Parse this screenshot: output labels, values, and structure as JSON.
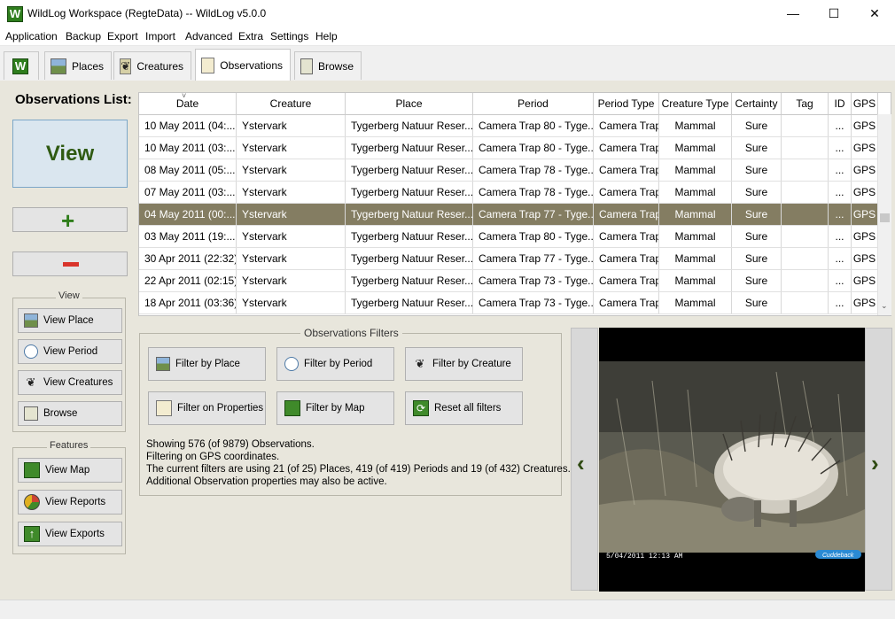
{
  "window": {
    "title": "WildLog Workspace (RegteData) -- WildLog v5.0.0",
    "logo_letter": "W",
    "controls": {
      "minimize": "—",
      "maximize": "☐",
      "close": "✕"
    }
  },
  "menu": [
    "Application",
    "Backup",
    "Export",
    "Import",
    "Advanced",
    "Extra",
    "Settings",
    "Help"
  ],
  "tabs": {
    "home_letter": "W",
    "places": "Places",
    "creatures": "Creatures",
    "observations": "Observations",
    "browse": "Browse"
  },
  "left": {
    "title": "Observations List:",
    "view_button": "View",
    "add_symbol": "+",
    "remove_symbol": "−",
    "view_group": {
      "title": "View",
      "view_place": "View  Place",
      "view_period": "View Period",
      "view_creatures": "View Creatures",
      "browse": "Browse"
    },
    "features_group": {
      "title": "Features",
      "view_map": "View Map",
      "view_reports": "View Reports",
      "view_exports": "View Exports"
    }
  },
  "table": {
    "sort_indicator": "˅",
    "columns": [
      "Date",
      "Creature",
      "Place",
      "Period",
      "Period Type",
      "Creature Type",
      "Certainty",
      "Tag",
      "ID",
      "GPS"
    ],
    "rows": [
      [
        "10 May 2011 (04:...",
        "Ystervark",
        "Tygerberg Natuur Reser...",
        "Camera Trap 80 - Tyge...",
        "Camera Trap",
        "Mammal",
        "Sure",
        "",
        "...",
        "GPS"
      ],
      [
        "10 May 2011 (03:...",
        "Ystervark",
        "Tygerberg Natuur Reser...",
        "Camera Trap 80 - Tyge...",
        "Camera Trap",
        "Mammal",
        "Sure",
        "",
        "...",
        "GPS"
      ],
      [
        "08 May 2011 (05:...",
        "Ystervark",
        "Tygerberg Natuur Reser...",
        "Camera Trap 78 - Tyge...",
        "Camera Trap",
        "Mammal",
        "Sure",
        "",
        "...",
        "GPS"
      ],
      [
        "07 May 2011 (03:...",
        "Ystervark",
        "Tygerberg Natuur Reser...",
        "Camera Trap 78 - Tyge...",
        "Camera Trap",
        "Mammal",
        "Sure",
        "",
        "...",
        "GPS"
      ],
      [
        "04 May 2011 (00:...",
        "Ystervark",
        "Tygerberg Natuur Reser...",
        "Camera Trap 77 - Tyge...",
        "Camera Trap",
        "Mammal",
        "Sure",
        "",
        "...",
        "GPS"
      ],
      [
        "03 May 2011 (19:...",
        "Ystervark",
        "Tygerberg Natuur Reser...",
        "Camera Trap 80 - Tyge...",
        "Camera Trap",
        "Mammal",
        "Sure",
        "",
        "...",
        "GPS"
      ],
      [
        "30 Apr 2011 (22:32)",
        "Ystervark",
        "Tygerberg Natuur Reser...",
        "Camera Trap 77 - Tyge...",
        "Camera Trap",
        "Mammal",
        "Sure",
        "",
        "...",
        "GPS"
      ],
      [
        "22 Apr 2011 (02:15)",
        "Ystervark",
        "Tygerberg Natuur Reser...",
        "Camera Trap 73 - Tyge...",
        "Camera Trap",
        "Mammal",
        "Sure",
        "",
        "...",
        "GPS"
      ],
      [
        "18 Apr 2011 (03:36)",
        "Ystervark",
        "Tygerberg Natuur Reser...",
        "Camera Trap 73 - Tyge...",
        "Camera Trap",
        "Mammal",
        "Sure",
        "",
        "...",
        "GPS"
      ]
    ],
    "selected_row": 4
  },
  "filters": {
    "title": "Observations Filters",
    "by_place": "Filter by Place",
    "by_period": "Filter by Period",
    "by_creature": "Filter by Creature",
    "on_properties": "Filter on Properties",
    "by_map": "Filter by Map",
    "reset": "Reset all filters",
    "info": [
      "Showing 576 (of 9879) Observations.",
      "Filtering on GPS coordinates.",
      "The current filters are using 21 (of 25) Places, 419 (of 419) Periods and 19 (of 432) Creatures.",
      "Additional Observation properties may also be active."
    ]
  },
  "image": {
    "timestamp": "5/04/2011 12:13 AM",
    "brand": "Cuddeback",
    "prev": "‹",
    "next": "›"
  },
  "colors": {
    "panel": "#e8e6dc",
    "selected_row": "#847d62",
    "accent_green": "#2f7d1a",
    "remove_red": "#d9342b"
  }
}
